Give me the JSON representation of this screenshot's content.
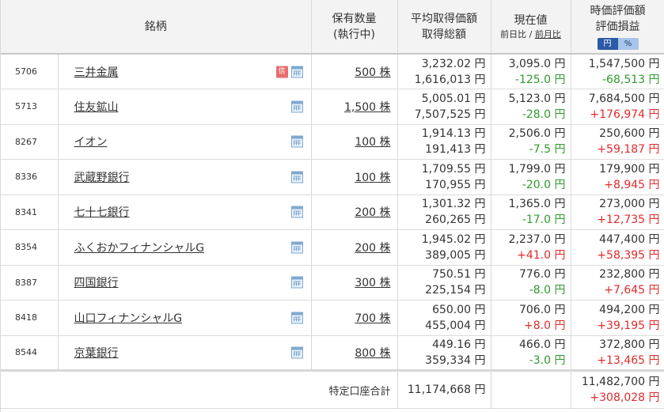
{
  "header": {
    "name": "銘柄",
    "qty_line1": "保有数量",
    "qty_line2": "(執行中)",
    "avg_line1": "平均取得価額",
    "avg_line2": "取得総額",
    "cur_line1": "現在値",
    "cur_sub_day": "前日比",
    "cur_sub_sep": " / ",
    "cur_sub_month": "前月比",
    "val_line1": "時価評価額",
    "val_line2": "評価損益",
    "toggle_yen": "円",
    "toggle_pct": "%"
  },
  "icons": {
    "calendar": "calendar-icon",
    "credit": "credit-badge-icon",
    "credit_label": "信"
  },
  "colors": {
    "gain": "#e02b2b",
    "loss": "#2f9a2f",
    "toggle_active": "#2b5aa6"
  },
  "rows": [
    {
      "code": "5706",
      "name": "三井金属",
      "credit": true,
      "qty": "500 株",
      "avg_price": "3,232.02 円",
      "total_cost": "1,616,013 円",
      "current": "3,095.0 円",
      "change": "-125.0 円",
      "change_dir": "neg",
      "market_value": "1,547,500 円",
      "pl": "-68,513 円",
      "pl_dir": "neg"
    },
    {
      "code": "5713",
      "name": "住友鉱山",
      "credit": false,
      "qty": "1,500 株",
      "avg_price": "5,005.01 円",
      "total_cost": "7,507,525 円",
      "current": "5,123.0 円",
      "change": "-28.0 円",
      "change_dir": "neg",
      "market_value": "7,684,500 円",
      "pl": "+176,974 円",
      "pl_dir": "pos"
    },
    {
      "code": "8267",
      "name": "イオン",
      "credit": false,
      "qty": "100 株",
      "avg_price": "1,914.13 円",
      "total_cost": "191,413 円",
      "current": "2,506.0 円",
      "change": "-7.5 円",
      "change_dir": "neg",
      "market_value": "250,600 円",
      "pl": "+59,187 円",
      "pl_dir": "pos"
    },
    {
      "code": "8336",
      "name": "武蔵野銀行",
      "credit": false,
      "qty": "100 株",
      "avg_price": "1,709.55 円",
      "total_cost": "170,955 円",
      "current": "1,799.0 円",
      "change": "-20.0 円",
      "change_dir": "neg",
      "market_value": "179,900 円",
      "pl": "+8,945 円",
      "pl_dir": "pos"
    },
    {
      "code": "8341",
      "name": "七十七銀行",
      "credit": false,
      "qty": "200 株",
      "avg_price": "1,301.32 円",
      "total_cost": "260,265 円",
      "current": "1,365.0 円",
      "change": "-17.0 円",
      "change_dir": "neg",
      "market_value": "273,000 円",
      "pl": "+12,735 円",
      "pl_dir": "pos"
    },
    {
      "code": "8354",
      "name": "ふくおかフィナンシャルG",
      "credit": false,
      "qty": "200 株",
      "avg_price": "1,945.02 円",
      "total_cost": "389,005 円",
      "current": "2,237.0 円",
      "change": "+41.0 円",
      "change_dir": "pos",
      "market_value": "447,400 円",
      "pl": "+58,395 円",
      "pl_dir": "pos"
    },
    {
      "code": "8387",
      "name": "四国銀行",
      "credit": false,
      "qty": "300 株",
      "avg_price": "750.51 円",
      "total_cost": "225,154 円",
      "current": "776.0 円",
      "change": "-8.0 円",
      "change_dir": "neg",
      "market_value": "232,800 円",
      "pl": "+7,645 円",
      "pl_dir": "pos"
    },
    {
      "code": "8418",
      "name": "山口フィナンシャルG",
      "credit": false,
      "qty": "700 株",
      "avg_price": "650.00 円",
      "total_cost": "455,004 円",
      "current": "706.0 円",
      "change": "+8.0 円",
      "change_dir": "pos",
      "market_value": "494,200 円",
      "pl": "+39,195 円",
      "pl_dir": "pos"
    },
    {
      "code": "8544",
      "name": "京葉銀行",
      "credit": false,
      "qty": "800 株",
      "avg_price": "449.16 円",
      "total_cost": "359,334 円",
      "current": "466.0 円",
      "change": "-3.0 円",
      "change_dir": "neg",
      "market_value": "372,800 円",
      "pl": "+13,465 円",
      "pl_dir": "pos"
    }
  ],
  "total": {
    "label": "特定口座合計",
    "total_cost": "11,174,668 円",
    "market_value": "11,482,700 円",
    "pl": "+308,028 円",
    "pl_dir": "pos"
  }
}
